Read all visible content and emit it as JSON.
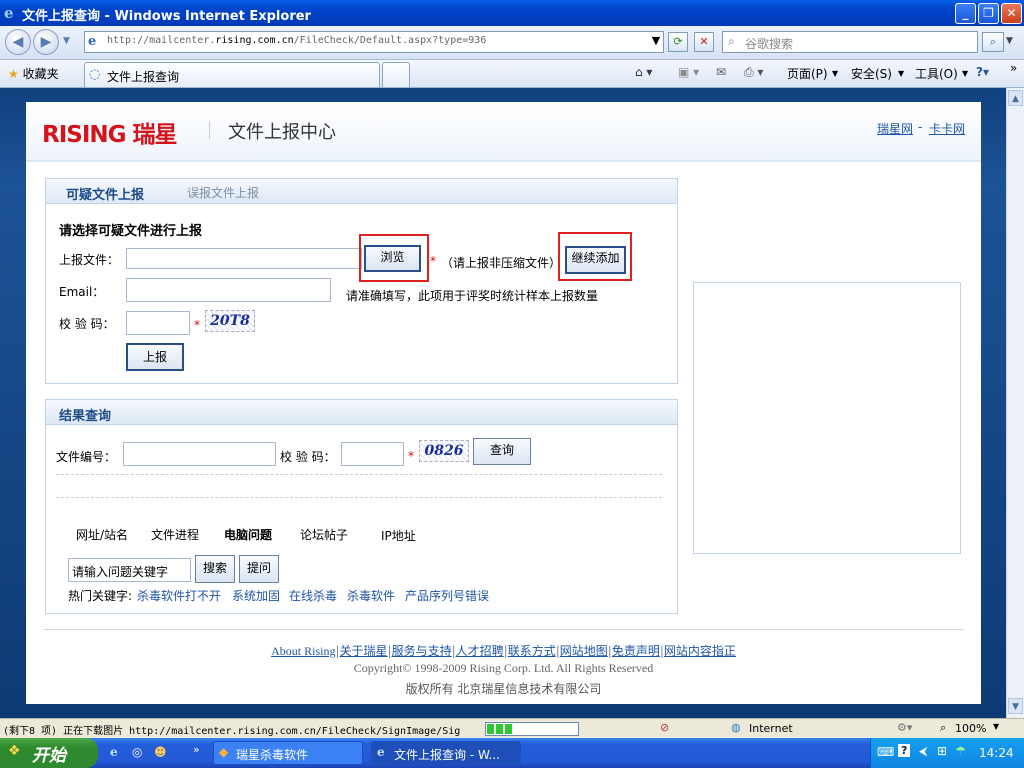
{
  "window": {
    "title": "文件上报查询 - Windows Internet Explorer",
    "url_prefix": "http://mailcenter.",
    "url_domain": "rising.com.cn",
    "url_path": "/FileCheck/Default.aspx?type=936",
    "search_placeholder": "谷歌搜索"
  },
  "favorites": {
    "label": "收藏夹",
    "tab_title": "文件上报查询",
    "commands": [
      "页面(P)",
      "安全(S)",
      "工具(O)"
    ]
  },
  "site": {
    "logo": "RISING 瑞星",
    "title": "文件上报中心",
    "top_links": [
      "瑞星网",
      "卡卡网"
    ],
    "top_sep": "-"
  },
  "upload": {
    "tab_active": "可疑文件上报",
    "tab_inactive": "误报文件上报",
    "heading": "请选择可疑文件进行上报",
    "file_label": "上报文件：",
    "browse_label": "浏览",
    "file_note": "（请上报非压缩文件）",
    "add_more_label": "继续添加",
    "email_label": "Email：",
    "email_note": "请准确填写，此项用于评奖时统计样本上报数量",
    "captcha_label": "校 验 码：",
    "captcha_text": "20T8",
    "submit_label": "上报"
  },
  "result": {
    "heading": "结果查询",
    "file_no_label": "文件编号：",
    "captcha_label": "校 验 码：",
    "captcha_text": "0826",
    "query_label": "查询",
    "categories": [
      "网址/站名",
      "文件进程",
      "电脑问题",
      "论坛帖子",
      "IP地址"
    ],
    "active_category": "电脑问题",
    "search_value": "请输入问题关键字",
    "search_label": "搜索",
    "ask_label": "提问",
    "hot_label": "热门关键字:",
    "hot_keywords": [
      "杀毒软件打不开",
      "系统加固",
      "在线杀毒",
      "杀毒软件",
      "产品序列号错误"
    ]
  },
  "footer": {
    "links": [
      "About Rising",
      "关于瑞星",
      "服务与支持",
      "人才招聘",
      "联系方式",
      "网站地图",
      "免责声明",
      "网站内容指正"
    ],
    "separator": "|",
    "copyright": "Copyright© 1998-2009 Rising Corp. Ltd. All Rights Reserved",
    "owner": "版权所有 北京瑞星信息技术有限公司"
  },
  "status": {
    "text": "(剩下8 项) 正在下载图片 http://mailcenter.rising.com.cn/FileCheck/SignImage/Sig",
    "progress": 0.3,
    "zone": "Internet",
    "zoom": "100%"
  },
  "taskbar": {
    "start": "开始",
    "items": [
      "瑞星杀毒软件",
      "文件上报查询 - W..."
    ],
    "time": "14:24"
  },
  "colors": {
    "brand_red": "#d2141c",
    "link_blue": "#1d56a6",
    "panel_heading": "#1d4b86"
  }
}
